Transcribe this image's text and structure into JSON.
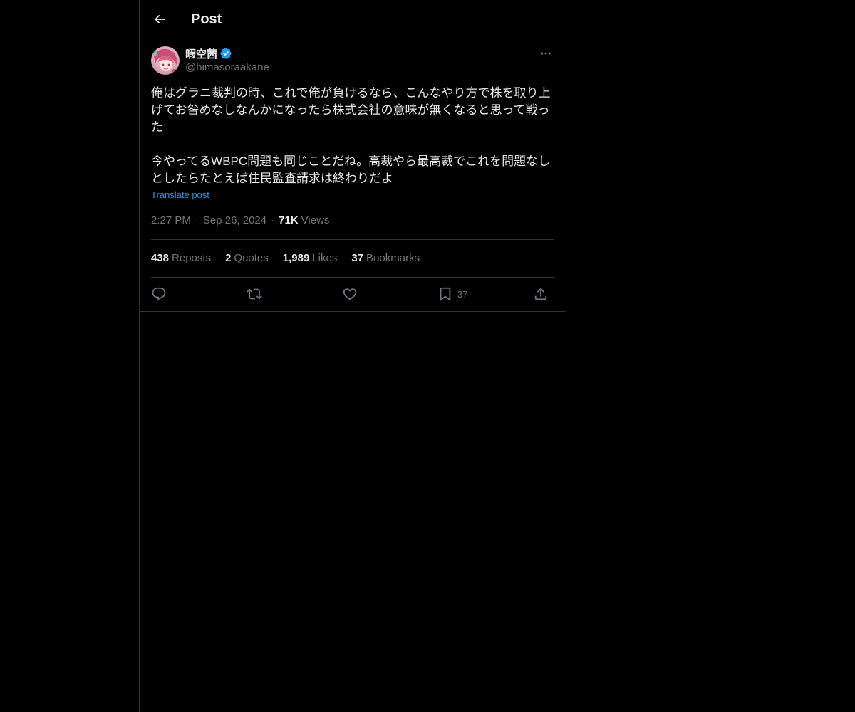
{
  "header": {
    "title": "Post"
  },
  "author": {
    "display_name": "暇空茜",
    "handle": "@himasoraakane",
    "verified": true
  },
  "post": {
    "text": "俺はグラニ裁判の時、これで俺が負けるなら、こんなやり方で株を取り上げてお咎めなしなんかになったら株式会社の意味が無くなると思って戦った\n\n今やってるWBPC問題も同じことだね。高裁やら最高裁でこれを問題なしとしたらたとえば住民監査請求は終わりだよ",
    "translate_label": "Translate post",
    "time": "2:27 PM",
    "date": "Sep 26, 2024",
    "views_count": "71K",
    "views_label": "Views"
  },
  "stats": [
    {
      "count": "438",
      "label": "Reposts"
    },
    {
      "count": "2",
      "label": "Quotes"
    },
    {
      "count": "1,989",
      "label": "Likes"
    },
    {
      "count": "37",
      "label": "Bookmarks"
    }
  ],
  "actions": {
    "bookmark_count": "37"
  },
  "icons": {
    "back": "arrow-left-icon",
    "verified": "verified-badge-icon",
    "more": "more-horizontal-icon",
    "reply": "reply-icon",
    "repost": "repost-icon",
    "like": "heart-icon",
    "bookmark": "bookmark-icon",
    "share": "share-icon"
  },
  "colors": {
    "background": "#000000",
    "text_primary": "#e7e9ea",
    "text_secondary": "#71767b",
    "accent": "#1d9bf0",
    "border": "#2f3336"
  }
}
